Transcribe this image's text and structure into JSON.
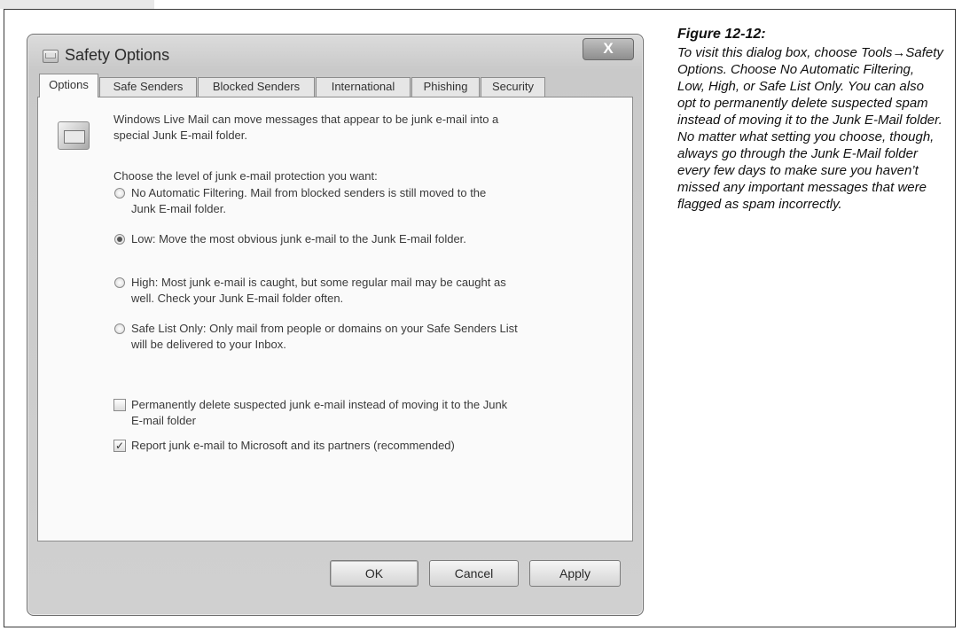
{
  "window": {
    "title": "Safety Options",
    "close_label": "X"
  },
  "tabs": [
    {
      "label": "Options",
      "active": true
    },
    {
      "label": "Safe Senders",
      "active": false
    },
    {
      "label": "Blocked Senders",
      "active": false
    },
    {
      "label": "International",
      "active": false
    },
    {
      "label": "Phishing",
      "active": false
    },
    {
      "label": "Security",
      "active": false
    }
  ],
  "options": {
    "intro_line1": "Windows Live Mail can move messages that appear to be junk e-mail into a",
    "intro_line2": "special Junk E-mail folder.",
    "level_prompt": "Choose the level of junk e-mail protection you want:",
    "radio_options": [
      {
        "line1": "No Automatic Filtering.  Mail from blocked senders is still moved to the",
        "line2": "Junk E-mail folder.",
        "selected": false
      },
      {
        "line1": "Low: Move the most obvious junk e-mail to the Junk E-mail folder.",
        "line2": "",
        "selected": true
      },
      {
        "line1": "High: Most junk e-mail is caught, but some regular mail may be caught as",
        "line2": "well.  Check your Junk E-mail folder often.",
        "selected": false
      },
      {
        "line1": "Safe List Only: Only mail from people or domains on your Safe Senders List",
        "line2": "will be delivered to your Inbox.",
        "selected": false
      }
    ],
    "checkboxes": [
      {
        "line1": "Permanently delete suspected junk e-mail instead of moving it to the Junk",
        "line2": "E-mail folder",
        "checked": false
      },
      {
        "line1": "Report junk e-mail to Microsoft and its partners (recommended)",
        "line2": "",
        "checked": true
      }
    ]
  },
  "buttons": {
    "ok": "OK",
    "cancel": "Cancel",
    "apply": "Apply"
  },
  "caption": {
    "title": "Figure 12-12:",
    "body": "To visit this dialog box, choose Tools→Safety Options. Choose No Automatic Filtering, Low, High, or Safe List Only. You can also opt to permanently delete suspected spam instead of moving it to the Junk E-Mail folder. No matter what setting you choose, though, always go through the Junk E-Mail folder every few days to make sure you haven’t missed any important messages that were flagged as spam incorrectly."
  }
}
